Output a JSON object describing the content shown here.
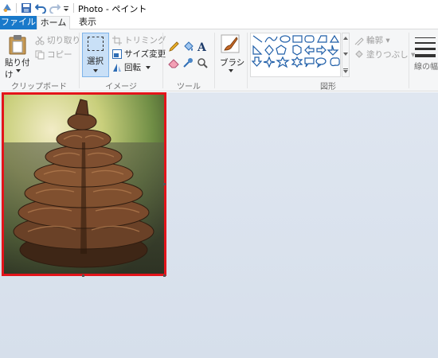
{
  "window": {
    "title": "Photo - ペイント"
  },
  "tabs": {
    "file": "ファイル",
    "home": "ホーム",
    "view": "表示"
  },
  "ribbon": {
    "clipboard": {
      "paste": "貼り付け",
      "cut": "切り取り",
      "copy": "コピー",
      "group": "クリップボード"
    },
    "image": {
      "select": "選択",
      "crop": "トリミング",
      "resize": "サイズ変更",
      "rotate": "回転",
      "group": "イメージ"
    },
    "tools": {
      "group": "ツール"
    },
    "brushes": {
      "label": "ブラシ"
    },
    "shapes": {
      "outline": "輪郭",
      "fill": "塗りつぶし",
      "group": "図形"
    },
    "size": {
      "label": "線の幅"
    }
  },
  "colors": {
    "accent": "#1979ca",
    "canvas_border": "#e3141b",
    "workspace": "#d6dfeb"
  }
}
